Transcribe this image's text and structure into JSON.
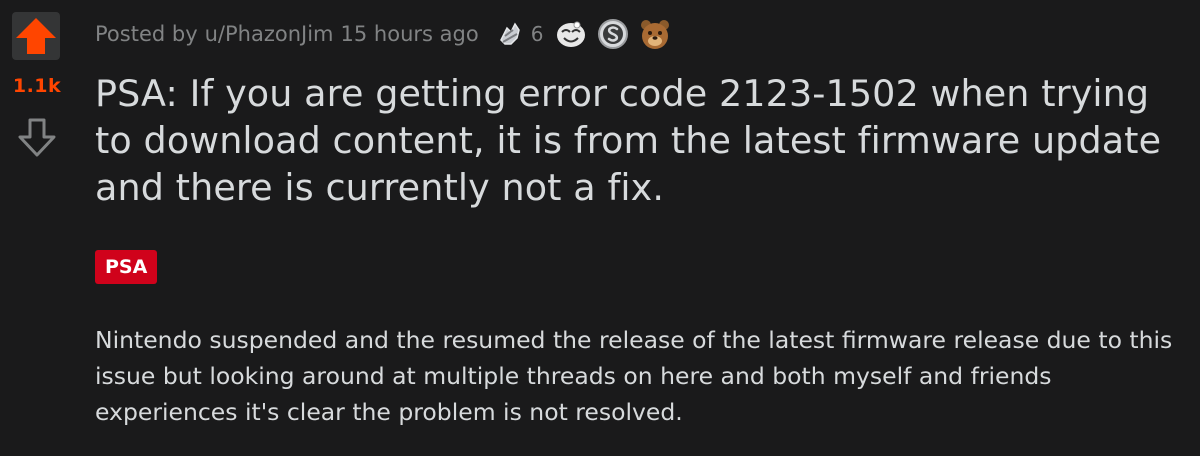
{
  "post": {
    "score": "1.1k",
    "meta": {
      "prefix": "Posted by",
      "author": "u/PhazonJim",
      "time": "15 hours ago"
    },
    "awards": [
      {
        "icon": "hand-award-icon",
        "count": "6"
      },
      {
        "icon": "wholesome-face-award-icon"
      },
      {
        "icon": "silver-coin-award-icon"
      },
      {
        "icon": "bear-award-icon"
      }
    ],
    "title": "PSA: If you are getting error code 2123-1502 when trying to download content, it is from the latest firmware update and there is currently not a fix.",
    "flair": "PSA",
    "body": "Nintendo suspended and the resumed the release of the latest firmware release due to this issue but looking around at multiple threads on here and both myself and friends experiences it's clear the problem is not resolved."
  },
  "colors": {
    "background": "#1a1a1b",
    "upvote": "#ff4500",
    "meta_text": "#818384",
    "title_text": "#d7dadc",
    "flair_bg": "#d0021b"
  }
}
